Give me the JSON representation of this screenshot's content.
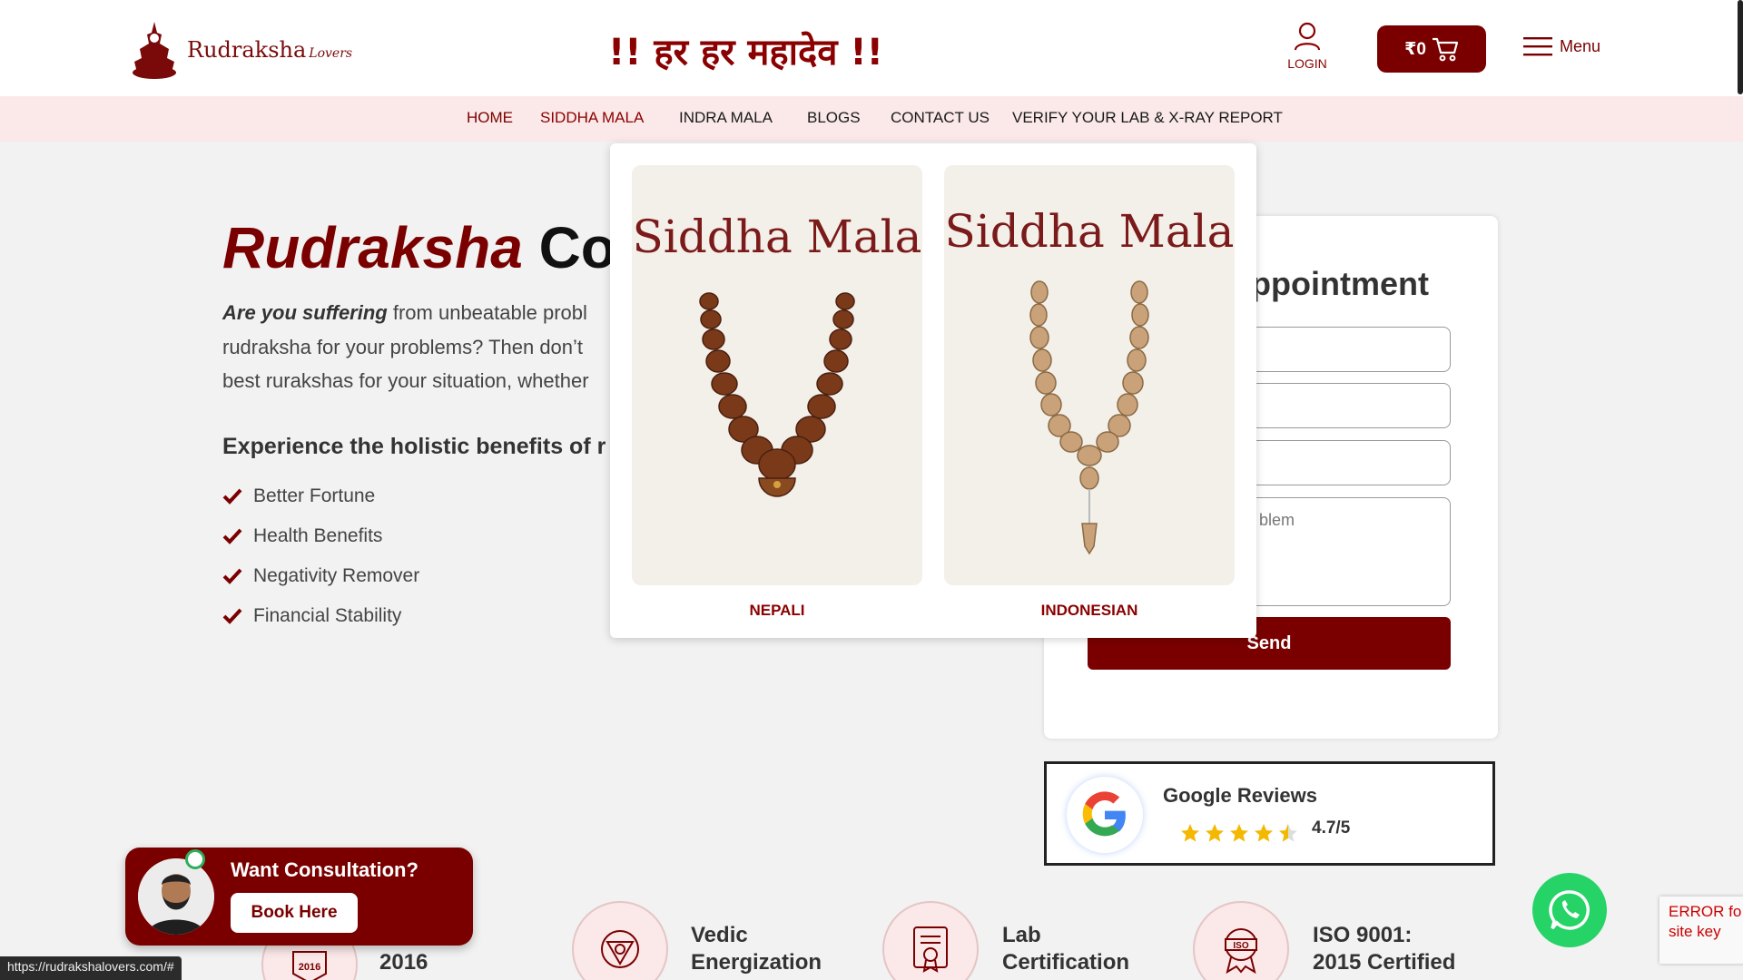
{
  "header": {
    "brand": "Rudraksha",
    "brand_suffix": "Lovers",
    "tagline": "!! हर हर महादेव !!",
    "login_label": "LOGIN",
    "cart_amount": "₹0",
    "menu_label": "Menu"
  },
  "nav": {
    "items": [
      {
        "label": "HOME"
      },
      {
        "label": "SIDDHA MALA"
      },
      {
        "label": "INDRA MALA"
      },
      {
        "label": "BLOGS"
      },
      {
        "label": "CONTACT US"
      },
      {
        "label": "VERIFY YOUR LAB & X-RAY REPORT"
      }
    ]
  },
  "hero": {
    "title_red": "Rudraksha",
    "title_black": "Co",
    "para_line1_em": "Are you suffering",
    "para_line1_rest": " from unbeatable probl",
    "para_line2": "rudraksha for your problems? Then don’t",
    "para_line3": "best rurakshas for your situation, whether",
    "benefits_title": "Experience the holistic benefits of r",
    "benefits": [
      "Better Fortune",
      "Health Benefits",
      "Negativity Remover",
      "Financial Stability"
    ]
  },
  "form": {
    "title": "ppointment",
    "problem_placeholder": "blem",
    "send_label": "Send"
  },
  "dropdown": {
    "cards": [
      {
        "image_title": "Siddha Mala",
        "label": "NEPALI"
      },
      {
        "image_title": "Siddha Mala",
        "label": "INDONESIAN"
      }
    ]
  },
  "reviews": {
    "title": "Google Reviews",
    "score": "4.7/5",
    "rating": 4.7
  },
  "consult": {
    "title": "Want Consultation?",
    "button": "Book Here"
  },
  "features": [
    {
      "line1": "",
      "line2": "2016",
      "badge": "2016"
    },
    {
      "line1": "Vedic",
      "line2": "Energization"
    },
    {
      "line1": "Lab",
      "line2": "Certification"
    },
    {
      "line1": "ISO 9001:",
      "line2": "2015 Certified",
      "badge": "ISO"
    }
  ],
  "recaptcha": {
    "line1": "ERROR fo",
    "line2": "site key"
  },
  "status_url": "https://rudrakshalovers.com/#",
  "colors": {
    "brand": "#7a0000",
    "nav_bg": "#fbe8e8",
    "whatsapp": "#25d366"
  }
}
